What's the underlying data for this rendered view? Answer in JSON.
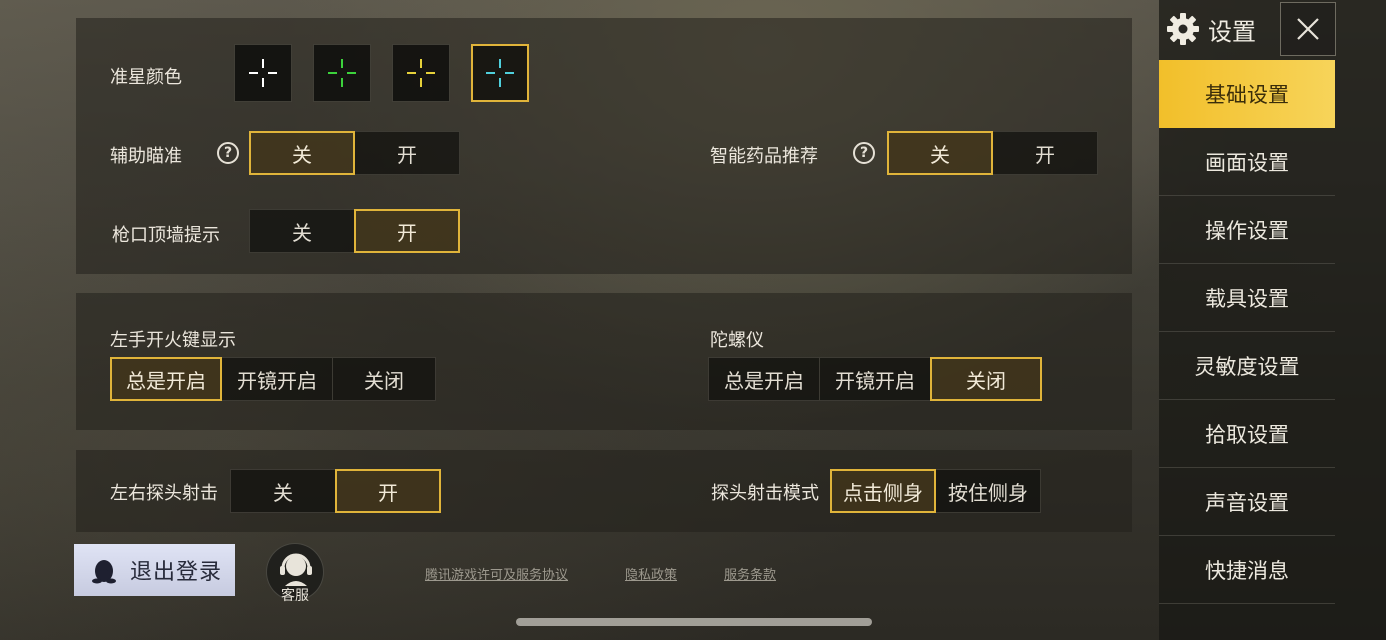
{
  "header": {
    "title": "设置",
    "settings_icon": "gear-icon",
    "close_icon": "close-icon"
  },
  "sidebar": {
    "items": [
      {
        "label": "基础设置",
        "active": true
      },
      {
        "label": "画面设置",
        "active": false
      },
      {
        "label": "操作设置",
        "active": false
      },
      {
        "label": "载具设置",
        "active": false
      },
      {
        "label": "灵敏度设置",
        "active": false
      },
      {
        "label": "拾取设置",
        "active": false
      },
      {
        "label": "声音设置",
        "active": false
      },
      {
        "label": "快捷消息",
        "active": false
      }
    ]
  },
  "crosshair": {
    "label": "准星颜色",
    "colors": [
      "#ffffff",
      "#3cd23c",
      "#e6d13a",
      "#4fd0dc"
    ],
    "selected_index": 3
  },
  "aim_assist": {
    "label": "辅助瞄准",
    "options": [
      "关",
      "开"
    ],
    "selected": "关"
  },
  "smart_meds": {
    "label": "智能药品推荐",
    "options": [
      "关",
      "开"
    ],
    "selected": "关"
  },
  "muzzle_wall": {
    "label": "枪口顶墙提示",
    "options": [
      "关",
      "开"
    ],
    "selected": "开"
  },
  "left_fire": {
    "label": "左手开火键显示",
    "options": [
      "总是开启",
      "开镜开启",
      "关闭"
    ],
    "selected": "总是开启"
  },
  "gyroscope": {
    "label": "陀螺仪",
    "options": [
      "总是开启",
      "开镜开启",
      "关闭"
    ],
    "selected": "关闭"
  },
  "peek_fire": {
    "label": "左右探头射击",
    "options": [
      "关",
      "开"
    ],
    "selected": "开"
  },
  "peek_mode": {
    "label": "探头射击模式",
    "options": [
      "点击侧身",
      "按住侧身"
    ],
    "selected": "点击侧身"
  },
  "footer": {
    "logout": "退出登录",
    "service": "客服",
    "links": [
      "腾讯游戏许可及服务协议",
      "隐私政策",
      "服务条款"
    ]
  },
  "colors": {
    "accent": "#e0b43a",
    "active_tab": "#f2bf2a"
  }
}
